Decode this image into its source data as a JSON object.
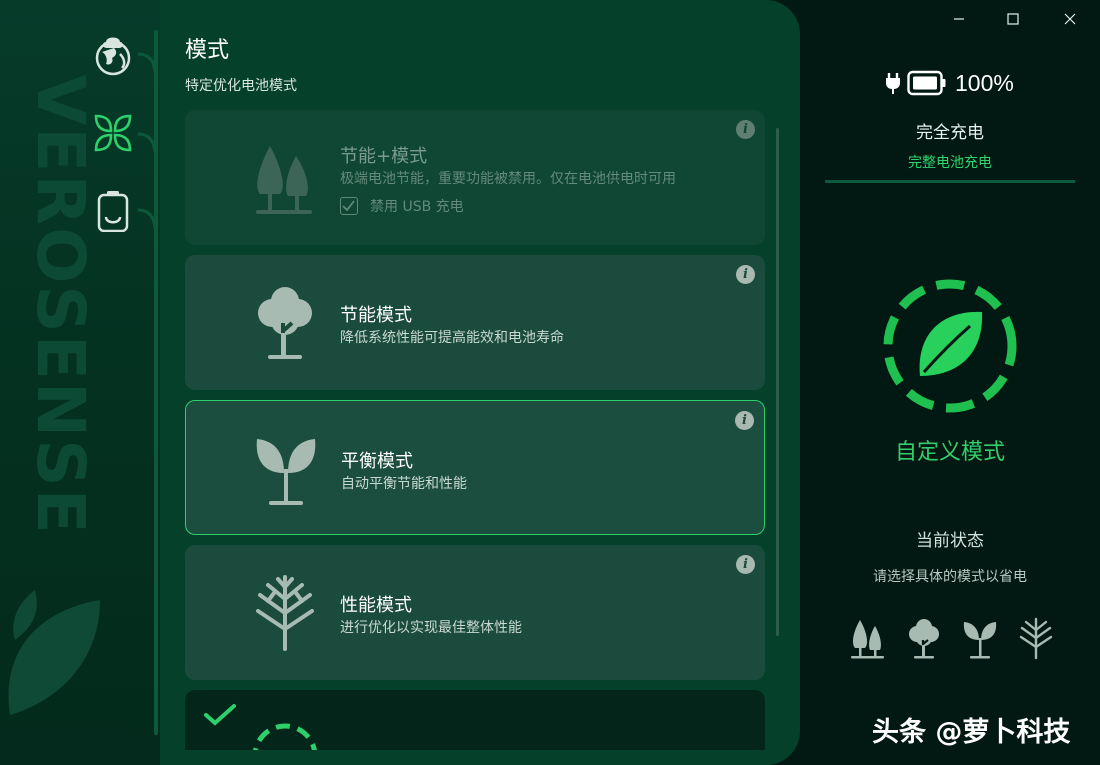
{
  "window": {
    "controls": [
      {
        "name": "minimize",
        "icon": "minimize-icon"
      },
      {
        "name": "maximize",
        "icon": "maximize-icon"
      },
      {
        "name": "close",
        "icon": "close-icon"
      }
    ]
  },
  "sidebar": {
    "brand": "VEROSENSE",
    "items": [
      {
        "name": "globe",
        "icon": "globe-tree-icon",
        "active": false
      },
      {
        "name": "modes",
        "icon": "leaves-icon",
        "active": true
      },
      {
        "name": "battery",
        "icon": "battery-icon",
        "active": false
      }
    ]
  },
  "panel": {
    "title": "模式",
    "subtitle": "特定优化电池模式",
    "modes": [
      {
        "title": "节能+模式",
        "desc": "极端电池节能，重要功能被禁用。仅在电池供电时可用",
        "option": "禁用 USB 充电",
        "option_checked": true,
        "state": "disabled",
        "icon": "two-trees-icon"
      },
      {
        "title": "节能模式",
        "desc": "降低系统性能可提高能效和电池寿命",
        "state": "normal",
        "icon": "tree-icon"
      },
      {
        "title": "平衡模式",
        "desc": "自动平衡节能和性能",
        "state": "active",
        "icon": "sprout-icon"
      },
      {
        "title": "性能模式",
        "desc": "进行优化以实现最佳整体性能",
        "state": "normal",
        "icon": "branch-icon"
      }
    ],
    "info_label": "i"
  },
  "status": {
    "battery_percent": "100%",
    "charge_state": "完全充电",
    "charge_mode": "完整电池充电",
    "current_mode": "自定义模式",
    "current_state_title": "当前状态",
    "current_state_hint": "请选择具体的模式以省电",
    "mini_icons": [
      "two-trees-icon",
      "tree-icon",
      "sprout-icon",
      "branch-icon"
    ]
  },
  "watermark": "头条 @萝卜科技",
  "colors": {
    "accent": "#2ed06b",
    "background": "#021812",
    "panel": "#05402b",
    "card": "#1a4b3c"
  }
}
